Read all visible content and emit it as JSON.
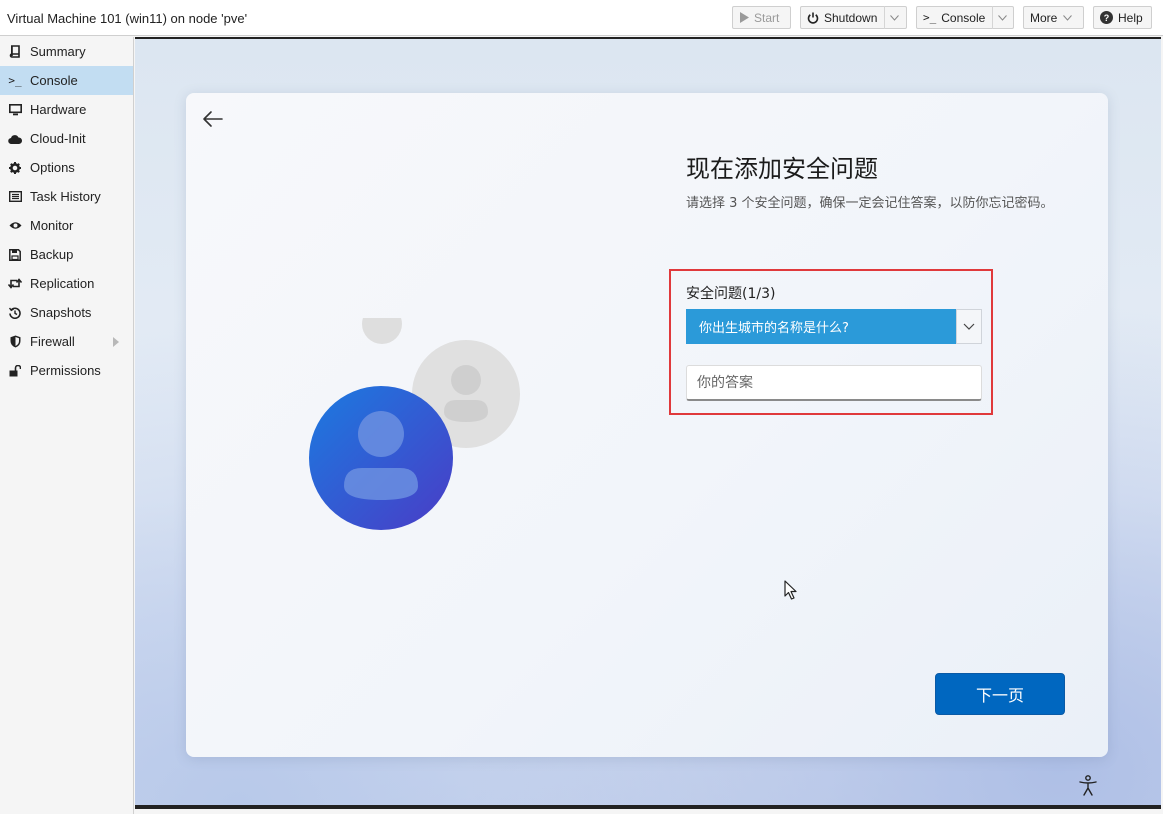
{
  "window": {
    "title": "Virtual Machine 101 (win11) on node 'pve'"
  },
  "toolbar": {
    "start_label": "Start",
    "shutdown_label": "Shutdown",
    "console_label": "Console",
    "more_label": "More",
    "help_label": "Help"
  },
  "sidebar": {
    "items": [
      {
        "label": "Summary",
        "icon": "book-icon"
      },
      {
        "label": "Console",
        "icon": "terminal-icon",
        "active": true
      },
      {
        "label": "Hardware",
        "icon": "monitor-icon"
      },
      {
        "label": "Cloud-Init",
        "icon": "cloud-icon"
      },
      {
        "label": "Options",
        "icon": "gear-icon"
      },
      {
        "label": "Task History",
        "icon": "list-icon"
      },
      {
        "label": "Monitor",
        "icon": "eye-icon"
      },
      {
        "label": "Backup",
        "icon": "floppy-icon"
      },
      {
        "label": "Replication",
        "icon": "retweet-icon"
      },
      {
        "label": "Snapshots",
        "icon": "history-icon"
      },
      {
        "label": "Firewall",
        "icon": "shield-icon"
      },
      {
        "label": "Permissions",
        "icon": "unlock-icon"
      }
    ]
  },
  "setup": {
    "heading": "现在添加安全问题",
    "description": "请选择 3 个安全问题，确保一定会记住答案，以防你忘记密码。",
    "question_label": "安全问题(1/3)",
    "selected_question": "你出生城市的名称是什么?",
    "answer_placeholder": "你的答案",
    "next_label": "下一页"
  },
  "colors": {
    "accent_blue": "#0067c0",
    "dropdown_blue": "#2b9ad9",
    "highlight_red": "#e0393b",
    "sidebar_active": "#c2ddf2"
  }
}
